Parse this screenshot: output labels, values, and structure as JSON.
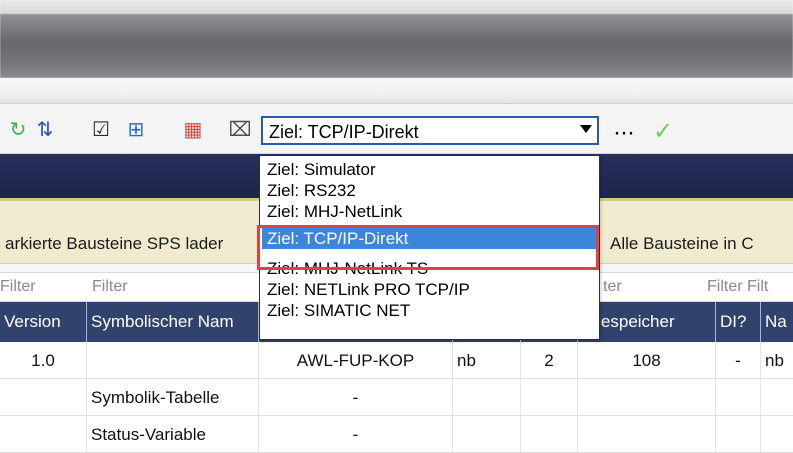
{
  "toolbar": {
    "icons": [
      {
        "name": "refresh-green-icon",
        "glyph": "↻",
        "color": "#39b54a"
      },
      {
        "name": "sort-vertical-icon",
        "glyph": "⇅",
        "color": "#2a4fc1"
      },
      {
        "name": "checklist-icon",
        "glyph": "☑",
        "color": "#2c2c2c"
      },
      {
        "name": "plus-square-icon",
        "glyph": "⊞",
        "color": "#1f6fd1"
      },
      {
        "name": "chart-icon",
        "glyph": "▦",
        "color": "#d64c4c"
      },
      {
        "name": "document-icon",
        "glyph": "⌧",
        "color": "#4f4f4f"
      }
    ],
    "target_selected": "Ziel: TCP/IP-Direkt",
    "more_label": "···",
    "confirm_label": "✓"
  },
  "dropdown": {
    "items": [
      "Ziel: Simulator",
      "Ziel: RS232",
      "Ziel: MHJ-NetLink",
      "Ziel: TCP/IP-Direkt",
      "Ziel: MHJ-NetLink TS",
      "Ziel: NETLink PRO TCP/IP",
      "Ziel: SIMATIC NET"
    ],
    "selected_index": 3
  },
  "info": {
    "left_text": "arkierte Bausteine SPS lader",
    "right_text": "Alle Bausteine in C"
  },
  "filters": {
    "f1": "Filter",
    "f2": "Filter",
    "f3": "ter",
    "f4": "Filter Filt"
  },
  "table": {
    "headers": [
      "Version",
      "Symbolischer Nam",
      "",
      "",
      "",
      "adespeicher",
      "DI?",
      "Na"
    ],
    "rows": [
      [
        "1.0",
        "",
        "AWL-FUP-KOP",
        "nb",
        "2",
        "108",
        "-",
        "nb"
      ],
      [
        "",
        "Symbolik-Tabelle",
        "-",
        "",
        "",
        "",
        "",
        ""
      ],
      [
        "",
        "Status-Variable",
        "-",
        "",
        "",
        "",
        "",
        ""
      ]
    ]
  }
}
